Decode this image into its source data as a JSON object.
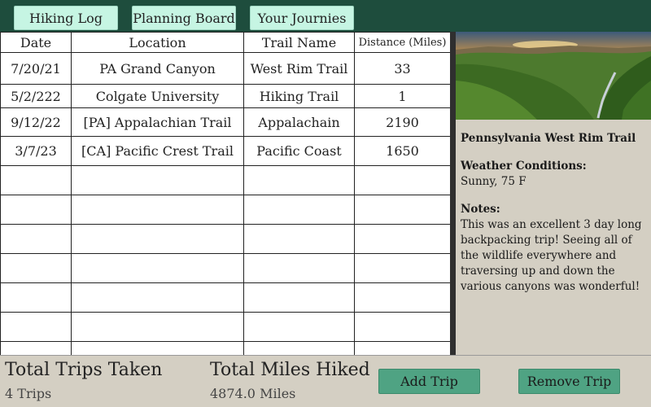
{
  "nav": {
    "tabs": [
      {
        "label": "Hiking Log"
      },
      {
        "label": "Planning Board"
      },
      {
        "label": "Your Journies"
      }
    ]
  },
  "table": {
    "headers": {
      "date": "Date",
      "location": "Location",
      "trail": "Trail Name",
      "distance": "Distance (Miles)"
    },
    "rows": [
      {
        "date": "7/20/21",
        "location": "PA Grand Canyon",
        "trail": "West Rim Trail",
        "distance": "33"
      },
      {
        "date": "5/2/222",
        "location": "Colgate University",
        "trail": "Hiking Trail",
        "distance": "1"
      },
      {
        "date": "9/12/22",
        "location": "[PA] Appalachian Trail",
        "trail": "Appalachain",
        "distance": "2190"
      },
      {
        "date": "3/7/23",
        "location": "[CA] Pacific Crest Trail",
        "trail": "Pacific Coast",
        "distance": "1650"
      }
    ],
    "empty_row_count": 7
  },
  "details": {
    "photo_icon": "canyon-landscape-photo",
    "title": "Pennsylvania West Rim Trail",
    "weather_heading": "Weather Conditions:",
    "weather_value": "Sunny, 75 F",
    "notes_heading": "Notes:",
    "notes_value": "This was an excellent 3 day long backpacking trip! Seeing all of the wildlife everywhere and traversing up and down the various canyons was wonderful!"
  },
  "stats": {
    "trips_label": "Total Trips Taken",
    "trips_value": "4 Trips",
    "miles_label": "Total Miles Hiked",
    "miles_value": "4874.0 Miles"
  },
  "actions": {
    "add_label": "Add Trip",
    "remove_label": "Remove Trip"
  },
  "colors": {
    "nav_background": "#1e4d3d",
    "nav_button": "#c6f5e3",
    "action_button": "#4fa383",
    "panel_background": "#d4cfc3"
  }
}
